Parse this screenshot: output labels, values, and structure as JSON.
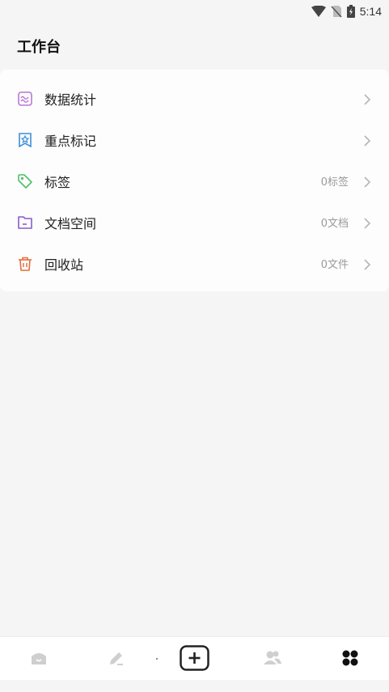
{
  "status_bar": {
    "time": "5:14",
    "icons": [
      "wifi-icon",
      "no-sim-icon",
      "battery-charging-icon"
    ]
  },
  "header": {
    "title": "工作台"
  },
  "menu": {
    "items": [
      {
        "label": "数据统计",
        "count": "",
        "icon": "chart-icon",
        "color": "#b877d8"
      },
      {
        "label": "重点标记",
        "count": "",
        "icon": "bookmark-star-icon",
        "color": "#3f8fd9"
      },
      {
        "label": "标签",
        "count": "0标签",
        "icon": "tag-icon",
        "color": "#4fbf6c"
      },
      {
        "label": "文档空间",
        "count": "0文档",
        "icon": "folder-icon",
        "color": "#8a5cc9"
      },
      {
        "label": "回收站",
        "count": "0文件",
        "icon": "trash-icon",
        "color": "#e2703d"
      }
    ]
  },
  "tab_bar": {
    "tabs": [
      {
        "name": "home-icon",
        "active": false
      },
      {
        "name": "edit-icon",
        "active": false
      },
      {
        "name": "add-icon",
        "active": false
      },
      {
        "name": "contacts-icon",
        "active": false
      },
      {
        "name": "workbench-icon",
        "active": true
      }
    ]
  },
  "colors": {
    "background": "#f5f5f5",
    "card": "#fdfdfd",
    "inactive_tab": "#cfcfcf",
    "active_tab": "#111111"
  }
}
